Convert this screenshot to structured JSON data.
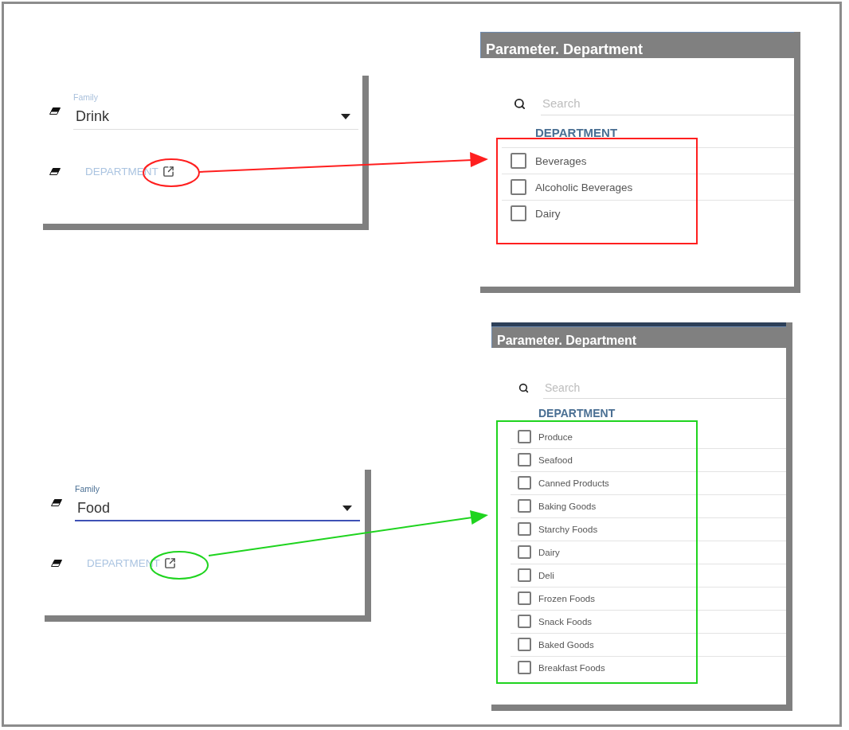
{
  "examples": [
    {
      "annotation": {
        "color": "#ff1f1f"
      },
      "family_field": {
        "label": "Family",
        "value": "Drink",
        "focused": false
      },
      "department_link": "DEPARTMENT",
      "dialog": {
        "window_behind": false,
        "title": "Parameter. Department",
        "search": {
          "placeholder": "Search"
        },
        "column_header": "DEPARTMENT",
        "items": [
          {
            "label": "Beverages",
            "checked": false
          },
          {
            "label": "Alcoholic Beverages",
            "checked": false
          },
          {
            "label": "Dairy",
            "checked": false
          }
        ]
      }
    },
    {
      "annotation": {
        "color": "#1fd41f"
      },
      "family_field": {
        "label": "Family",
        "value": "Food",
        "focused": true
      },
      "department_link": "DEPARTMENT",
      "dialog": {
        "window_behind": true,
        "title": "Parameter. Department",
        "search": {
          "placeholder": "Search"
        },
        "column_header": "DEPARTMENT",
        "items": [
          {
            "label": "Produce",
            "checked": false
          },
          {
            "label": "Seafood",
            "checked": false
          },
          {
            "label": "Canned Products",
            "checked": false
          },
          {
            "label": "Baking Goods",
            "checked": false
          },
          {
            "label": "Starchy Foods",
            "checked": false
          },
          {
            "label": "Dairy",
            "checked": false
          },
          {
            "label": "Deli",
            "checked": false
          },
          {
            "label": "Frozen Foods",
            "checked": false
          },
          {
            "label": "Snack Foods",
            "checked": false
          },
          {
            "label": "Baked Goods",
            "checked": false
          },
          {
            "label": "Breakfast Foods",
            "checked": false
          }
        ]
      }
    }
  ]
}
